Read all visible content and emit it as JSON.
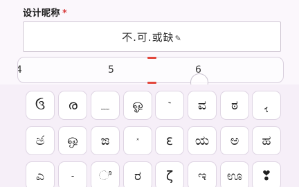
{
  "form": {
    "label": "设计昵称",
    "required_mark": "*",
    "nickname_value": "不.可.或缺"
  },
  "picker": {
    "values": [
      "4",
      "5",
      "6"
    ],
    "selected_index": 1,
    "accent_color": "#e2463c"
  },
  "keyboard": {
    "rows": [
      [
        "ઉ",
        "ര",
        "﹏",
        "ஓ",
        "‶",
        "ವ",
        "ಠ",
        "ﮨ"
      ],
      [
        "ඡ",
        "ஒ",
        "ಙ",
        "ˣ",
        "ɛ",
        "ಯ",
        "ಅ",
        "ಹ"
      ],
      [
        "ಎ",
        "-",
        "ಿ",
        "ರ",
        "ζ",
        "ಇ",
        "ಊ",
        "❣"
      ]
    ]
  },
  "icons": {
    "pencil": "pencil-icon",
    "drag_handle": "circle-handle"
  }
}
